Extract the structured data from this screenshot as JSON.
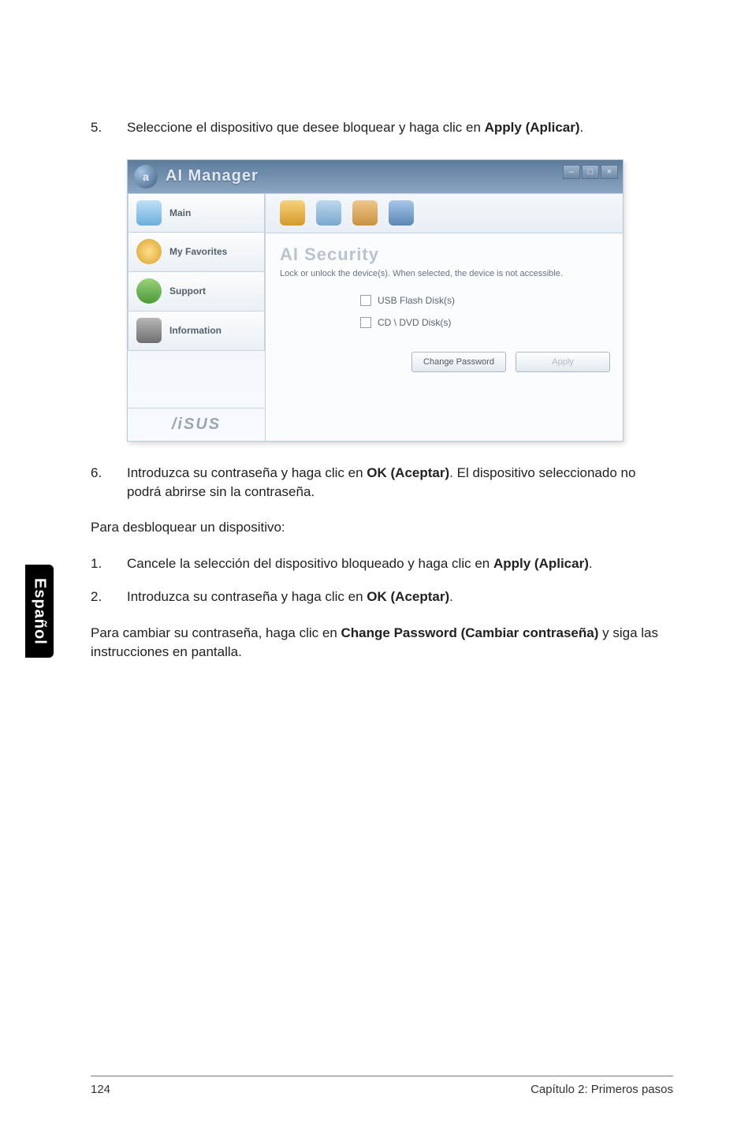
{
  "sidebar_tab": "Español",
  "steps": {
    "s5_num": "5.",
    "s5_pre": "Seleccione el dispositivo que desee bloquear y haga clic en ",
    "s5_bold": "Apply (Aplicar)",
    "s5_post": ".",
    "s6_num": "6.",
    "s6_pre": "Introduzca su contraseña y haga clic en ",
    "s6_bold": "OK (Aceptar)",
    "s6_post": ". El dispositivo seleccionado no podrá abrirse sin la contraseña.",
    "unlock_heading": "Para desbloquear un dispositivo:",
    "u1_num": "1.",
    "u1_pre": "Cancele la selección del dispositivo bloqueado y haga clic en ",
    "u1_bold": "Apply (Aplicar)",
    "u1_post": ".",
    "u2_num": "2.",
    "u2_pre": "Introduzca su contraseña y haga clic en ",
    "u2_bold": "OK (Aceptar)",
    "u2_post": ".",
    "pw_pre": "Para cambiar su contraseña, haga clic en ",
    "pw_bold": "Change Password (Cambiar contraseña)",
    "pw_post": " y siga las instrucciones en pantalla."
  },
  "shot": {
    "app_title": "AI Manager",
    "win_min": "–",
    "win_max": "□",
    "win_close": "×",
    "nav": {
      "main": "Main",
      "favorites": "My Favorites",
      "support": "Support",
      "information": "Information"
    },
    "brand": "/iSUS",
    "section_title": "AI Security",
    "description": "Lock or unlock the device(s). When selected, the device is not accessible.",
    "opt_usb": "USB Flash Disk(s)",
    "opt_cddvd": "CD \\ DVD Disk(s)",
    "btn_change": "Change Password",
    "btn_apply": "Apply"
  },
  "footer": {
    "page_no": "124",
    "chapter": "Capítulo 2: Primeros pasos"
  }
}
